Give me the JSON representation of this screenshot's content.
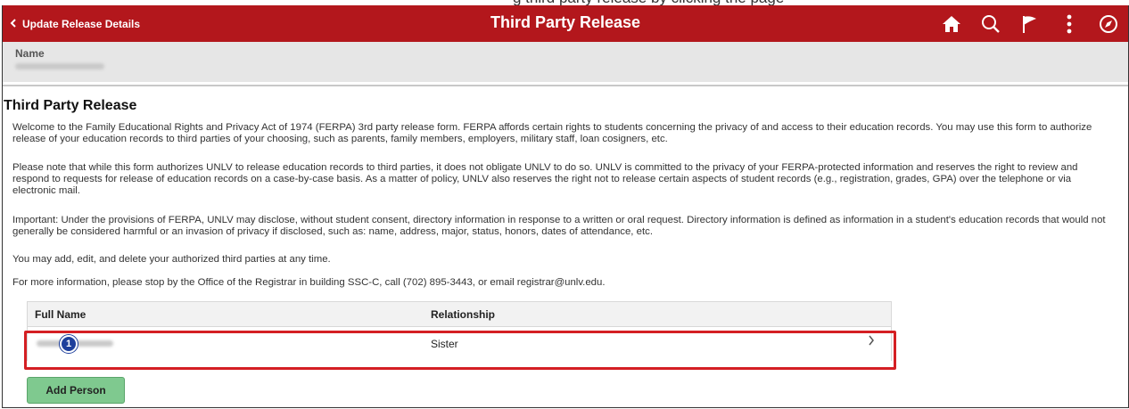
{
  "top_caption": "g  third party release  by clicking the page",
  "banner": {
    "back_label": "Update Release Details",
    "title": "Third Party Release",
    "color": "#b3171c",
    "icons": [
      "home-icon",
      "search-icon",
      "flag-icon",
      "more-actions-icon",
      "navigator-compass-icon"
    ]
  },
  "name_section": {
    "label": "Name"
  },
  "section": {
    "heading": "Third Party Release",
    "paragraphs": [
      "Welcome to the Family Educational Rights and Privacy Act of 1974 (FERPA) 3rd party release form.  FERPA affords certain rights to students concerning the privacy of and access to their education records.  You may use this form to authorize release of your education records to third parties of your choosing, such as parents, family members, employers, military staff, loan cosigners, etc.",
      "Please note that while this form authorizes UNLV to release education records to third parties, it does not obligate UNLV to do so.  UNLV is committed to the privacy of your FERPA-protected information and reserves the right to review and respond to requests for release of education records on a case-by-case basis.  As a matter of policy, UNLV also reserves the right not to release certain aspects of student records (e.g., registration, grades, GPA) over the telephone or via electronic mail.",
      "Important:  Under the provisions of FERPA, UNLV may disclose, without student consent, directory information in response to a written or oral request.  Directory information is defined as information in a student's education records that would not generally be considered harmful or an invasion of privacy if disclosed, such as:  name, address, major, status, honors, dates of attendance, etc.",
      "You may add, edit, and delete your authorized third parties at any time.",
      "For more information, please stop by the Office of the Registrar in building SSC-C, call (702) 895-3443, or email registrar@unlv.edu."
    ]
  },
  "grid": {
    "columns": [
      "Full Name",
      "Relationship"
    ],
    "rows": [
      {
        "relationship": "Sister",
        "callout_number": "1"
      }
    ]
  },
  "add_button_label": "Add Person",
  "colors": {
    "highlight": "#d41f23",
    "add_button": "#7fc98f",
    "callout": "#1d3f9c"
  }
}
